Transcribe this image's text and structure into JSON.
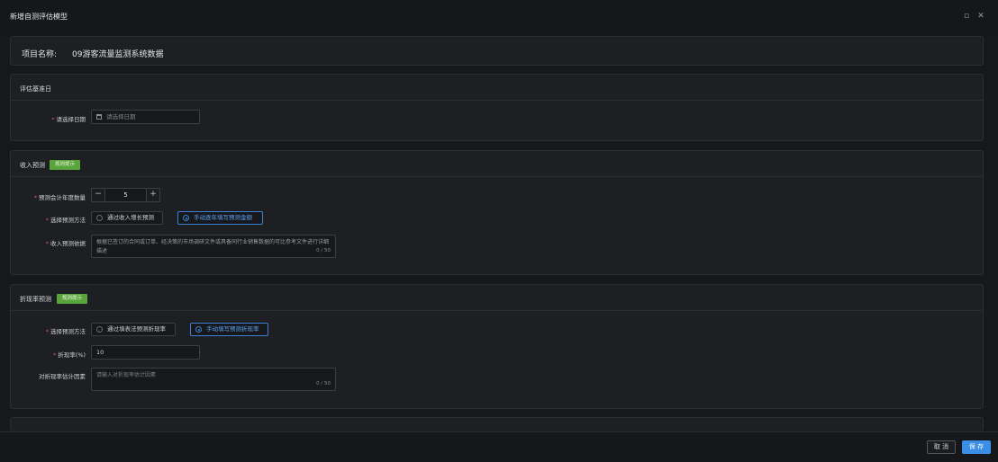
{
  "window": {
    "title": "新增自测评估模型",
    "maximize_glyph": "▫",
    "close_glyph": "✕"
  },
  "project": {
    "label": "项目名称:",
    "name": "09游客流量监测系统数据"
  },
  "valuation_date": {
    "section_title": "评估基准日",
    "date_label": "请选择日期",
    "date_placeholder": "请选择日期"
  },
  "revenue": {
    "section_title": "收入预测",
    "tag": "规则提示",
    "years_label": "预测会计年度数量",
    "years_value": "5",
    "minus": "−",
    "plus": "+",
    "method_label": "选择预测方法",
    "method_option_1": "通过收入增长预测",
    "method_option_2": "手动逐年填写预测金额",
    "method_selected": "手动逐年填写预测金额",
    "basis_label": "收入预测依据",
    "basis_placeholder": "根据已签订的合同或订单、经决策的市场调研文件或具备同行业销售数据的可比参考文件进行详细描述",
    "basis_counter": "0 / 50"
  },
  "discount": {
    "section_title": "折现率预测",
    "tag": "规则提示",
    "method_label": "选择预测方法",
    "method_option_1": "通过填表法预测折现率",
    "method_option_2": "手动填写预测折现率",
    "method_selected": "手动填写预测折现率",
    "rate_label": "折现率(%)",
    "rate_value": "10",
    "factors_label": "对折现率估计因素",
    "factors_placeholder": "请输入对折现率估计因素",
    "factors_counter": "0 / 50"
  },
  "footer": {
    "cancel_label": "取 消",
    "save_label": "保 存"
  },
  "colors": {
    "accent": "#3a8ee6",
    "tag_green": "#5aa53b",
    "required": "#e0524d"
  }
}
